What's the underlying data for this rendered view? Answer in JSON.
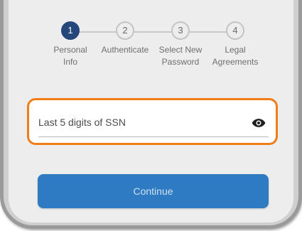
{
  "stepper": {
    "steps": [
      {
        "number": "1",
        "label_line1": "Personal",
        "label_line2": "Info",
        "active": true
      },
      {
        "number": "2",
        "label_line1": "Authenticate",
        "label_line2": "",
        "active": false
      },
      {
        "number": "3",
        "label_line1": "Select New",
        "label_line2": "Password",
        "active": false
      },
      {
        "number": "4",
        "label_line1": "Legal",
        "label_line2": "Agreements",
        "active": false
      }
    ]
  },
  "ssn_field": {
    "placeholder": "Last 5 digits of SSN",
    "value": "",
    "icon": "eye-icon"
  },
  "continue": {
    "label": "Continue"
  },
  "colors": {
    "active_step": "#26477a",
    "highlight_border": "#f07d16",
    "button": "#2e7bc4"
  }
}
